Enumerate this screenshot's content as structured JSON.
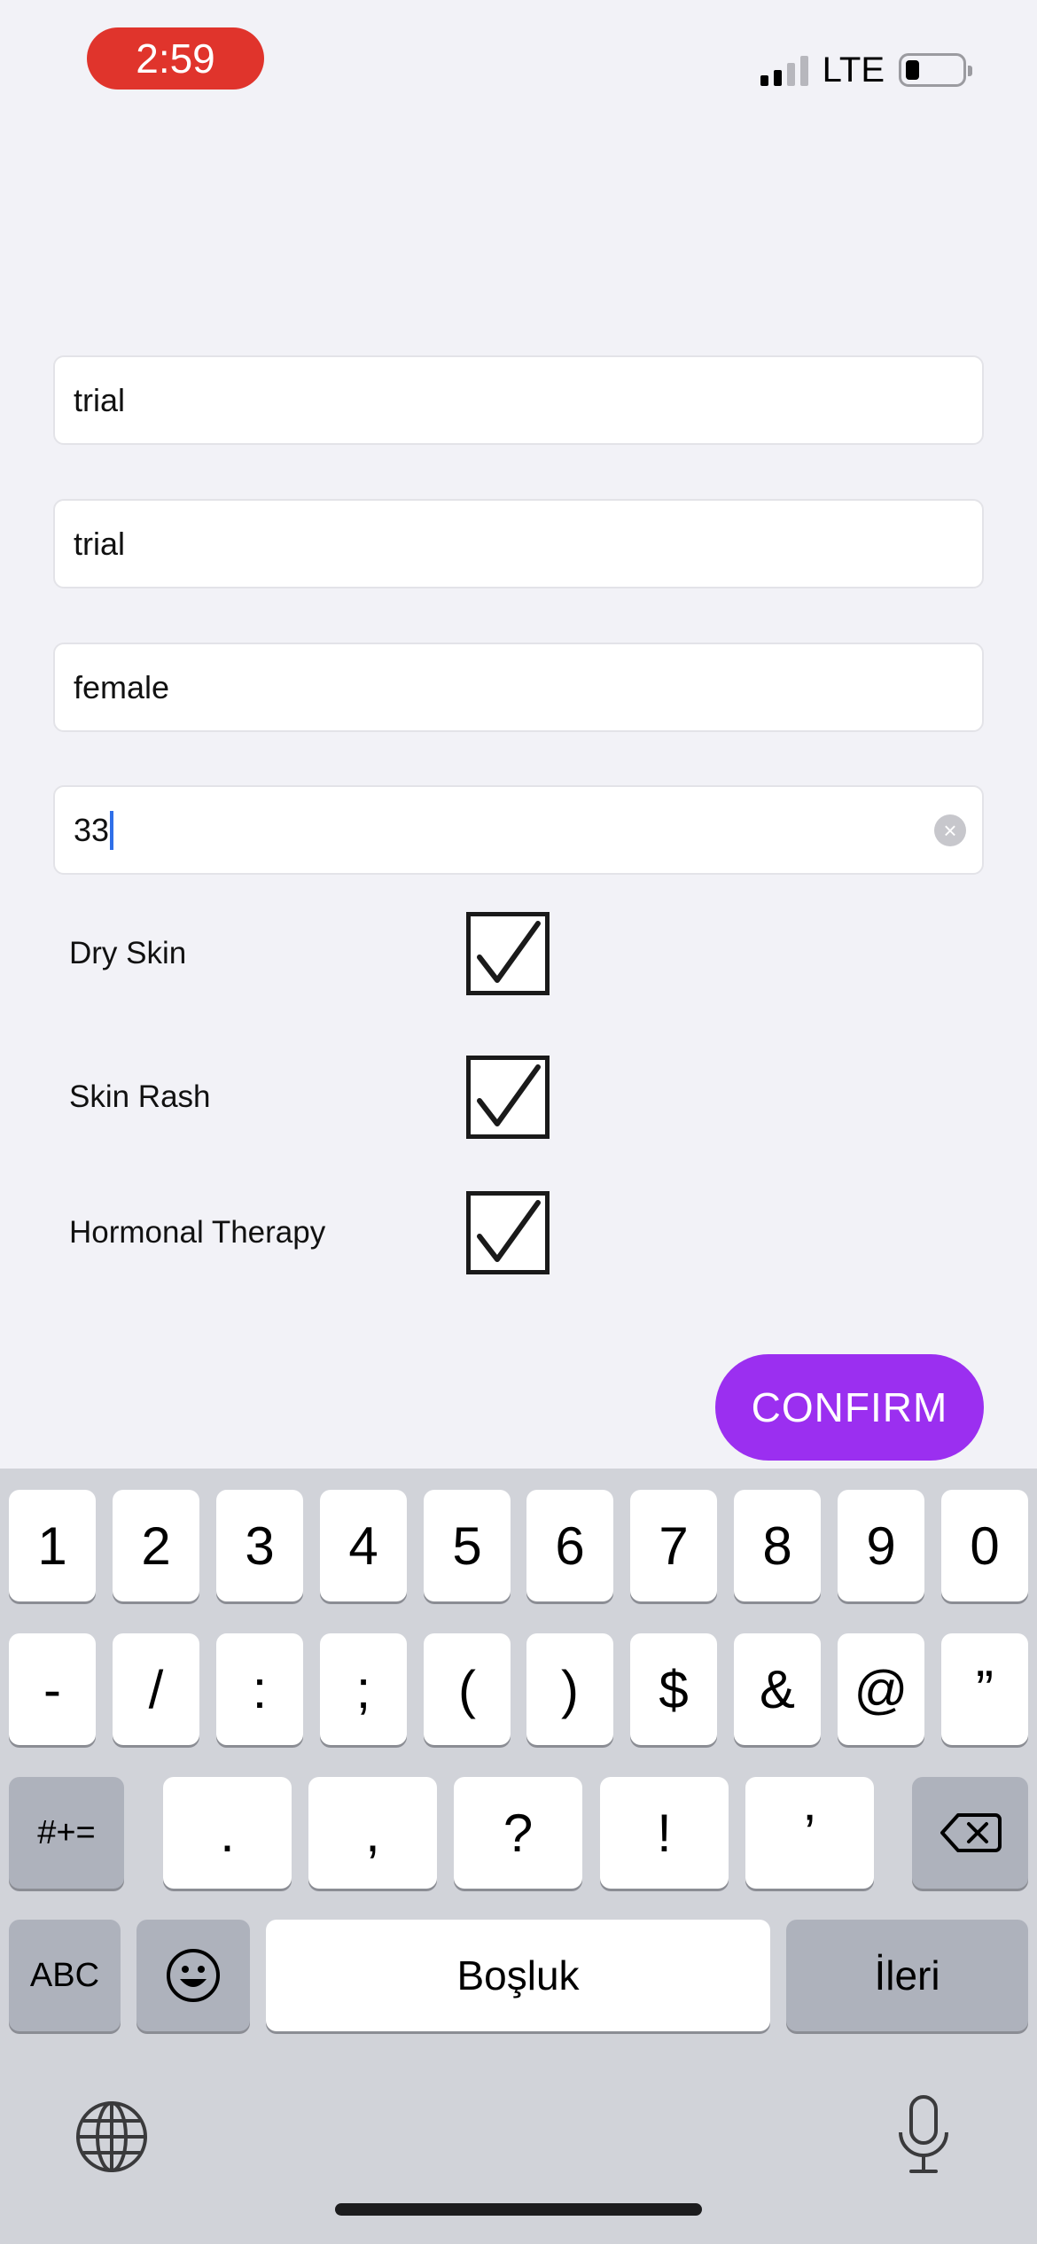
{
  "status_bar": {
    "time": "2:59",
    "network": "LTE"
  },
  "form": {
    "fields": [
      {
        "value": "trial"
      },
      {
        "value": "trial"
      },
      {
        "value": "female"
      },
      {
        "value": "33"
      }
    ],
    "checkboxes": [
      {
        "label": "Dry Skin",
        "checked": true
      },
      {
        "label": "Skin Rash",
        "checked": true
      },
      {
        "label": "Hormonal Therapy",
        "checked": true
      }
    ],
    "confirm_label": "CONFIRM"
  },
  "keyboard": {
    "row1": [
      "1",
      "2",
      "3",
      "4",
      "5",
      "6",
      "7",
      "8",
      "9",
      "0"
    ],
    "row2": [
      "-",
      "/",
      ":",
      ";",
      "(",
      ")",
      "$",
      "&",
      "@",
      "”"
    ],
    "symbols_toggle": "#+=",
    "row3": [
      ".",
      ",",
      "?",
      "!",
      "’"
    ],
    "abc_label": "ABC",
    "space_label": "Boşluk",
    "return_label": "İleri"
  },
  "colors": {
    "accent": "#9b2ff0",
    "time_pill": "#e0342c",
    "cursor": "#2f6fe8"
  }
}
